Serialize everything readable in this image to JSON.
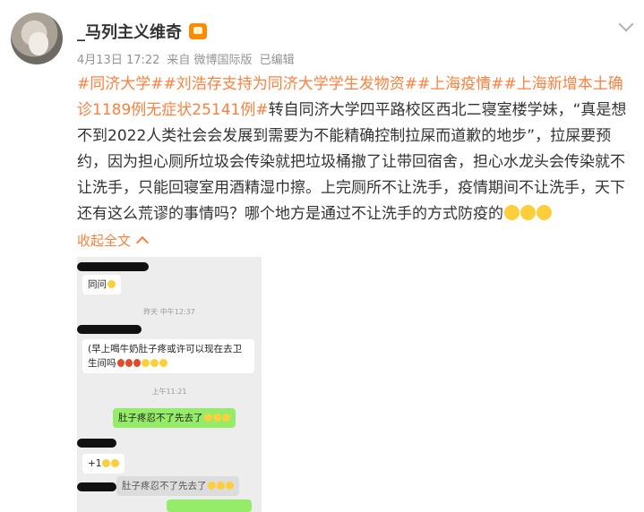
{
  "post": {
    "username": "_马列主义维奇",
    "meta": {
      "date": "4月13日 17:22",
      "source": "来自 微博国际版",
      "edited": "已编辑"
    },
    "tags": [
      "#同济大学#",
      "#刘浩存支持为同济大学学生发物资#",
      "#上海疫情#",
      "#上海新增本土确诊1189例无症状25141例#"
    ],
    "text": "转自同济大学四平路校区西北二寝室楼学妹，“真是想不到2022人类社会会发展到需要为不能精确控制拉屎而道歉的地步”，拉屎要预约，因为担心厕所垃圾会传染就把垃圾桶撤了让带回宿舍，担心水龙头会传染就不让洗手，只能回寝室用酒精湿巾擦。上完厕所不让洗手，疫情期间不让洗手，天下还有这么荒谬的事情吗？哪个地方是通过不让洗手的方式防疫的",
    "collapse_label": "收起全文"
  },
  "chat": {
    "msg1": "同问",
    "time1": "昨天 中午12:37",
    "msg2": "(早上喝牛奶肚子疼或许可以现在去卫生间吗",
    "time2": "上午11:21",
    "msg3": "肚子疼忍不了先去了",
    "msg4": "+1",
    "quote": "肚子疼忍不了先去了"
  },
  "colors": {
    "accent": "#ff8140",
    "chat_green": "#95ec69",
    "chat_bg": "#ededed"
  },
  "icons": [
    "avatar",
    "member-badge-icon",
    "more-chevron-icon",
    "collapse-arrow-icon",
    "emoji-icon"
  ]
}
